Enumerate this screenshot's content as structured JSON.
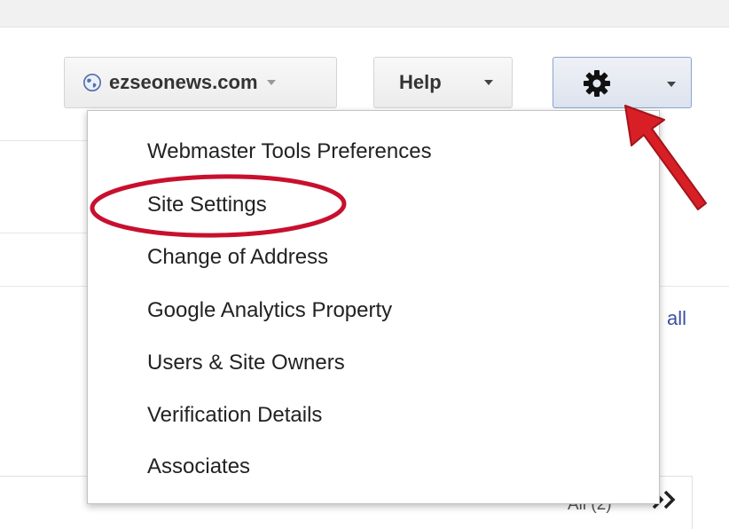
{
  "header": {
    "site_selector_label": "ezseonews.com",
    "help_label": "Help"
  },
  "icons": {
    "site": "globe-icon",
    "settings": "gear-icon",
    "dropdown": "chevron-down-icon",
    "next": "double-chevron-right-icon"
  },
  "settings_menu": {
    "items": [
      {
        "label": "Webmaster Tools Preferences"
      },
      {
        "label": "Site Settings",
        "highlighted": true
      },
      {
        "label": "Change of Address"
      },
      {
        "label": "Google Analytics Property"
      },
      {
        "label": "Users & Site Owners"
      },
      {
        "label": "Verification Details"
      },
      {
        "label": "Associates"
      }
    ]
  },
  "background": {
    "view_all_link": "all",
    "pager_text": "All (2)"
  },
  "colors": {
    "highlight_ring": "#c8102e",
    "arrow": "#d81f26",
    "link": "#3b4fa0",
    "active_button_border": "#8aa4d0"
  }
}
